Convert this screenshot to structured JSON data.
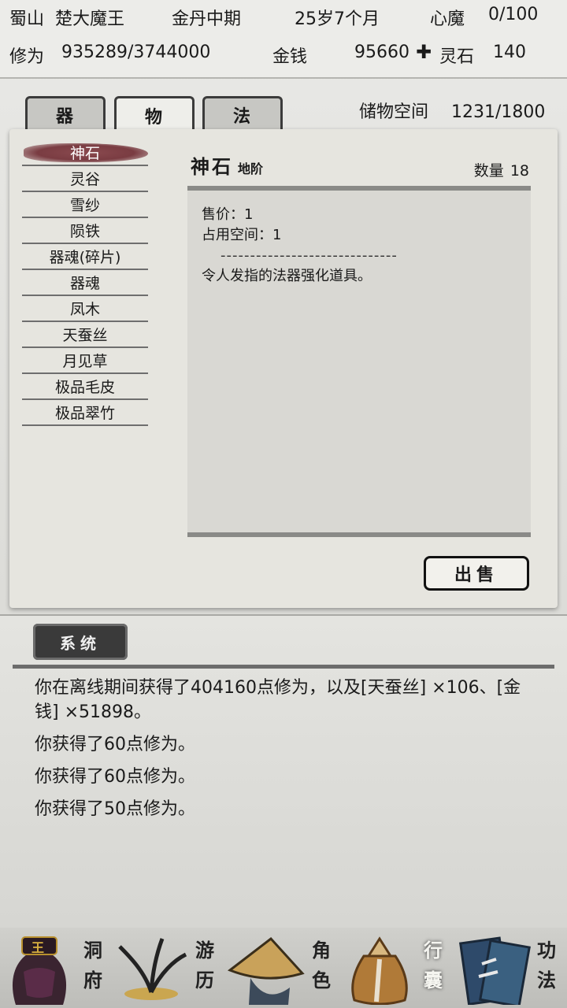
{
  "header": {
    "location": "蜀山",
    "player_name": "楚大魔王",
    "realm": "金丹中期",
    "age": "25岁7个月",
    "heart_demon_label": "心魔",
    "heart_demon_value": "0/100",
    "cultivation_label": "修为",
    "cultivation_value": "935289/3744000",
    "money_label": "金钱",
    "money_value": "95660",
    "spirit_stone_label": "灵石",
    "spirit_stone_value": "140"
  },
  "tabs": [
    {
      "label": "器"
    },
    {
      "label": "物"
    },
    {
      "label": "法"
    }
  ],
  "storage": {
    "label": "储物空间",
    "value": "1231/1800"
  },
  "items": [
    {
      "label": "神石"
    },
    {
      "label": "灵谷"
    },
    {
      "label": "雪纱"
    },
    {
      "label": "陨铁"
    },
    {
      "label": "器魂(碎片)"
    },
    {
      "label": "器魂"
    },
    {
      "label": "凤木"
    },
    {
      "label": "天蚕丝"
    },
    {
      "label": "月见草"
    },
    {
      "label": "极品毛皮"
    },
    {
      "label": "极品翠竹"
    }
  ],
  "detail": {
    "name": "神石",
    "grade": "地阶",
    "quantity_label": "数量",
    "quantity_value": "18",
    "price_line": "售价：1",
    "space_line": "占用空间：1",
    "separator": "------------------------------",
    "description": "令人发指的法器强化道具。"
  },
  "sell_label": "出售",
  "log": {
    "tab_label": "系统",
    "lines": [
      "你在离线期间获得了404160点修为，以及[天蚕丝] ×106、[金钱] ×51898。",
      "你获得了60点修为。",
      "你获得了60点修为。",
      "你获得了50点修为。"
    ]
  },
  "nav": [
    {
      "label_top": "洞",
      "label_bottom": "府"
    },
    {
      "label_top": "游",
      "label_bottom": "历"
    },
    {
      "label_top": "角",
      "label_bottom": "色"
    },
    {
      "label_top": "行",
      "label_bottom": "囊"
    },
    {
      "label_top": "功",
      "label_bottom": "法"
    }
  ],
  "nav_icon_badge": "王",
  "colors": {
    "selected_highlight": "#7a3c42",
    "panel_bg": "#e6e5df"
  }
}
